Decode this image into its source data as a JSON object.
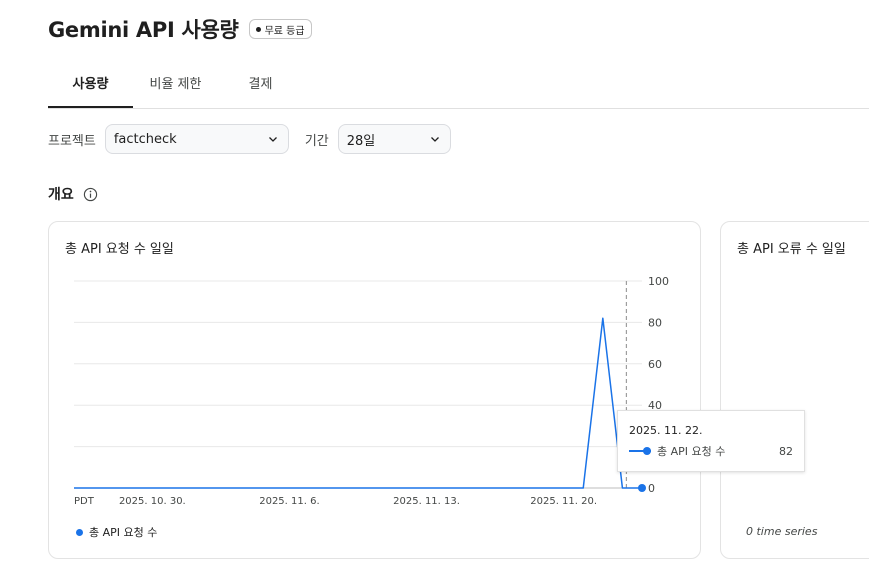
{
  "header": {
    "title": "Gemini API 사용량",
    "tier_badge": "무료 등급"
  },
  "tabs": [
    {
      "label": "사용량",
      "active": true
    },
    {
      "label": "비율 제한",
      "active": false
    },
    {
      "label": "결제",
      "active": false
    }
  ],
  "filters": {
    "project_label": "프로젝트",
    "project_value": "factcheck",
    "period_label": "기간",
    "period_value": "28일"
  },
  "overview": {
    "title": "개요",
    "info_icon": "info-icon"
  },
  "colors": {
    "series": "#1a73e8",
    "grid": "#e8e8e8",
    "crosshair": "#9e9e9e"
  },
  "chart_data": [
    {
      "type": "line",
      "title": "총 API 요청 수 일일",
      "timezone_label": "PDT",
      "x": [
        "2025-10-26",
        "2025-10-27",
        "2025-10-28",
        "2025-10-29",
        "2025-10-30",
        "2025-10-31",
        "2025-11-01",
        "2025-11-02",
        "2025-11-03",
        "2025-11-04",
        "2025-11-05",
        "2025-11-06",
        "2025-11-07",
        "2025-11-08",
        "2025-11-09",
        "2025-11-10",
        "2025-11-11",
        "2025-11-12",
        "2025-11-13",
        "2025-11-14",
        "2025-11-15",
        "2025-11-16",
        "2025-11-17",
        "2025-11-18",
        "2025-11-19",
        "2025-11-20",
        "2025-11-21",
        "2025-11-22",
        "2025-11-23",
        "2025-11-24"
      ],
      "x_tick_labels": [
        "2025. 10. 30.",
        "2025. 11. 6.",
        "2025. 11. 13.",
        "2025. 11. 20."
      ],
      "series": [
        {
          "name": "총 API 요청 수",
          "values": [
            0,
            0,
            0,
            0,
            0,
            0,
            0,
            0,
            0,
            0,
            0,
            0,
            0,
            0,
            0,
            0,
            0,
            0,
            0,
            0,
            0,
            0,
            0,
            0,
            0,
            0,
            0,
            82,
            0,
            0
          ]
        }
      ],
      "y_ticks": [
        0,
        20,
        40,
        60,
        80,
        100
      ],
      "y_tick_labels": [
        "0",
        "40",
        "60",
        "80",
        "100"
      ],
      "ylim": [
        0,
        100
      ],
      "y_axis_side": "right",
      "grid": true,
      "legend": "bottom-left",
      "tooltip": {
        "date": "2025. 11. 22.",
        "series_name": "총 API 요청 수",
        "value": "82"
      }
    },
    {
      "type": "line",
      "title": "총 API 오류 수 일일",
      "series": [],
      "empty_note": "0 time series"
    }
  ]
}
